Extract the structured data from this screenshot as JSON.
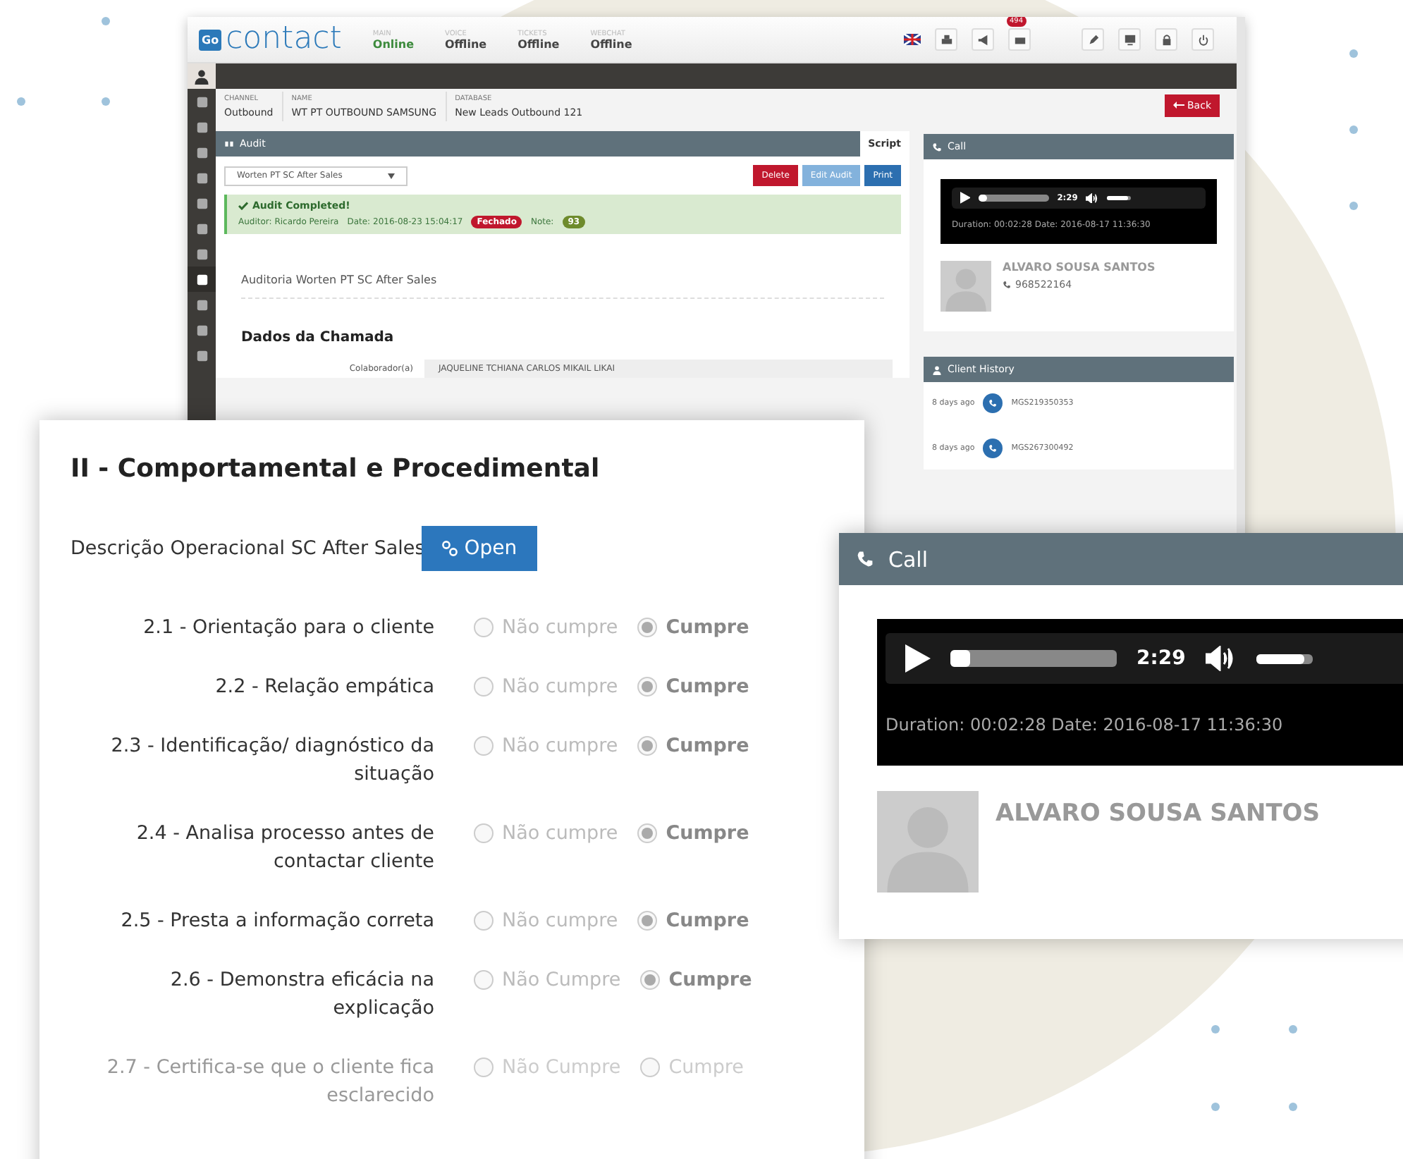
{
  "app": {
    "logo_mark": "Go",
    "logo_text": "contact",
    "statuses": [
      {
        "label": "MAIN",
        "value": "Online",
        "online": true
      },
      {
        "label": "VOICE",
        "value": "Offline",
        "online": false
      },
      {
        "label": "TICKETS",
        "value": "Offline",
        "online": false
      },
      {
        "label": "WEBCHAT",
        "value": "Offline",
        "online": false
      }
    ],
    "notification_badge": "494",
    "sidebar": [
      {
        "selected": false
      },
      {
        "selected": false
      },
      {
        "selected": false
      },
      {
        "selected": false
      },
      {
        "selected": false
      },
      {
        "selected": false
      },
      {
        "selected": false
      },
      {
        "selected": true
      },
      {
        "selected": false
      },
      {
        "selected": false
      },
      {
        "selected": false
      }
    ],
    "info": [
      {
        "label": "CHANNEL",
        "value": "Outbound"
      },
      {
        "label": "NAME",
        "value": "WT PT OUTBOUND SAMSUNG"
      },
      {
        "label": "DATABASE",
        "value": "New Leads Outbound 121"
      }
    ],
    "back_button": "Back",
    "audit": {
      "title": "Audit",
      "script_tab": "Script",
      "template_select": "Worten PT SC After Sales",
      "buttons": [
        {
          "label": "Delete",
          "kind": "danger"
        },
        {
          "label": "Edit Audit",
          "kind": "muted"
        },
        {
          "label": "Print",
          "kind": "primary"
        }
      ],
      "alert_title": "Audit Completed!",
      "auditor_label": "Auditor:",
      "auditor": "Ricardo Pereira",
      "date_label": "Date:",
      "date": "2016-08-23 15:04:17",
      "status": "Fechado",
      "note_label": "Note:",
      "note": "93",
      "form_title": "Auditoria Worten PT SC After Sales",
      "section": "Dados da Chamada",
      "field_label": "Colaborador(a)",
      "field_value": "JAQUELINE TCHIANA CARLOS MIKAIL LIKAI"
    },
    "call": {
      "title": "Call",
      "time": "2:29",
      "progress": {
        "level": 0.06
      },
      "volume": {
        "level": 0.85
      },
      "details": "Duration: 00:02:28 Date: 2016-08-17 11:36:30",
      "client_name": "ALVARO SOUSA SANTOS",
      "phone": "968522164"
    },
    "history": {
      "title": "Client History",
      "items": [
        {
          "ago": "8 days ago",
          "id": "MGS219350353"
        },
        {
          "ago": "8 days ago",
          "id": "MGS267300492"
        }
      ]
    }
  },
  "audit_form": {
    "title": "II - Comportamental e Procedimental",
    "description": "Descrição Operacional SC After Sales",
    "open_button": "Open",
    "questions": [
      {
        "label": "2.1 - Orientação para o cliente",
        "disabled": false,
        "options": [
          {
            "label": "Não cumpre",
            "selected": false
          },
          {
            "label": "Cumpre",
            "selected": true
          }
        ]
      },
      {
        "label": "2.2 - Relação empática",
        "disabled": false,
        "options": [
          {
            "label": "Não cumpre",
            "selected": false
          },
          {
            "label": "Cumpre",
            "selected": true
          }
        ]
      },
      {
        "label": "2.3 - Identificação/ diagnóstico da situação",
        "disabled": false,
        "options": [
          {
            "label": "Não cumpre",
            "selected": false
          },
          {
            "label": "Cumpre",
            "selected": true
          }
        ]
      },
      {
        "label": "2.4 - Analisa processo antes de contactar cliente",
        "disabled": false,
        "options": [
          {
            "label": "Não cumpre",
            "selected": false
          },
          {
            "label": "Cumpre",
            "selected": true
          }
        ]
      },
      {
        "label": "2.5 - Presta a informação correta",
        "disabled": false,
        "options": [
          {
            "label": "Não cumpre",
            "selected": false
          },
          {
            "label": "Cumpre",
            "selected": true
          }
        ]
      },
      {
        "label": "2.6 - Demonstra eficácia na explicação",
        "disabled": false,
        "options": [
          {
            "label": "Não Cumpre",
            "selected": false
          },
          {
            "label": "Cumpre",
            "selected": true
          }
        ]
      },
      {
        "label": "2.7 - Certifica-se que o cliente fica esclarecido",
        "disabled": true,
        "options": [
          {
            "label": "Não Cumpre",
            "selected": false
          },
          {
            "label": "Cumpre",
            "selected": false
          }
        ]
      }
    ]
  },
  "call_popup": {
    "title": "Call",
    "time": "2:29",
    "progress": {
      "level": 0.06
    },
    "volume": {
      "level": 0.85
    },
    "details": "Duration: 00:02:28 Date: 2016-08-17 11:36:30",
    "client_name": "ALVARO SOUSA SANTOS"
  }
}
